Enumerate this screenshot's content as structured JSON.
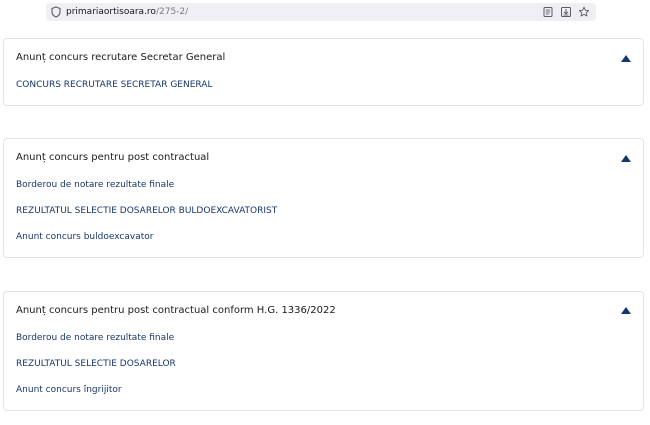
{
  "browser": {
    "url_domain": "primariaortisoara.ro",
    "url_path": "/275-2/",
    "icons": [
      "shield-icon",
      "reader-view-icon",
      "download-icon",
      "bookmark-star-icon"
    ]
  },
  "sections": [
    {
      "title": "Anunț concurs recrutare Secretar General",
      "links": [
        "CONCURS RECRUTARE SECRETAR GENERAL"
      ]
    },
    {
      "title": "Anunț concurs pentru post contractual",
      "links": [
        "Borderou de notare rezultate finale",
        "REZULTATUL SELECTIE DOSARELOR BULDOEXCAVATORIST",
        "Anunt concurs buldoexcavator"
      ]
    },
    {
      "title": "Anunț concurs pentru post contractual conform H.G. 1336/2022",
      "links": [
        "Borderou de notare rezultate finale",
        "REZULTATUL SELECTIE DOSARELOR",
        "Anunt concurs îngrijitor"
      ]
    }
  ],
  "colors": {
    "link": "#17366b",
    "caret": "#17366b",
    "card_border": "#e3e3e3"
  }
}
